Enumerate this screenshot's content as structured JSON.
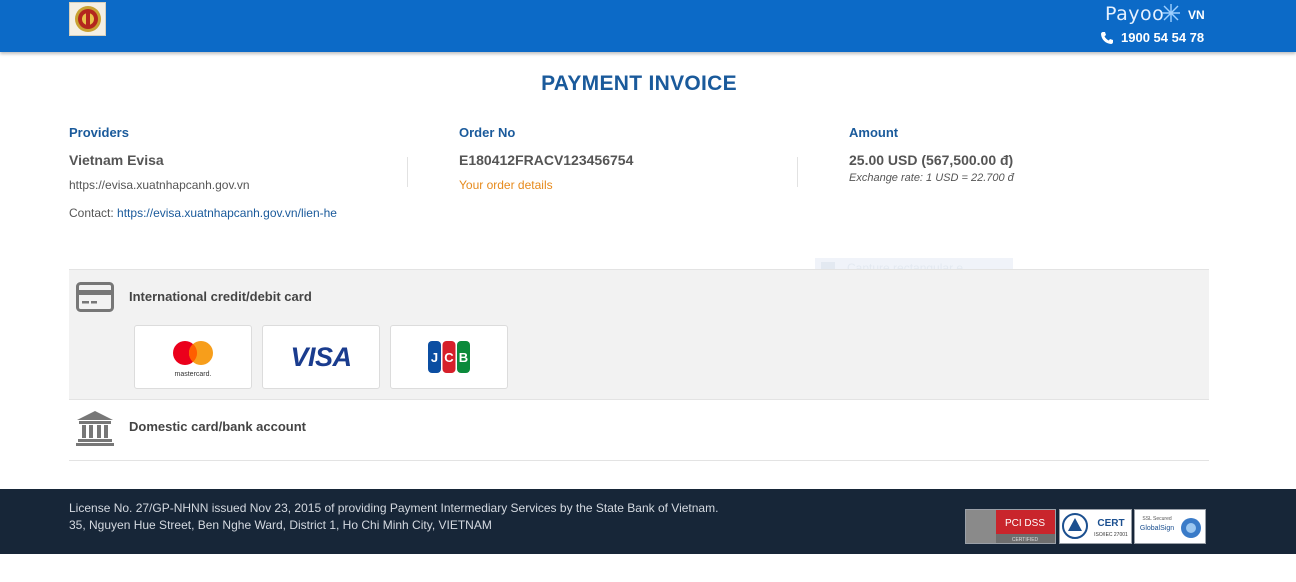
{
  "header": {
    "brand": "Payoo",
    "language": "VN",
    "hotline": "1900 54 54 78",
    "bar_color": "#0c6ac7"
  },
  "page": {
    "title": "PAYMENT INVOICE"
  },
  "invoice": {
    "provider": {
      "label": "Providers",
      "name": "Vietnam Evisa",
      "website": "https://evisa.xuatnhapcanh.gov.vn",
      "contact_label": "Contact:",
      "contact_link": "https://evisa.xuatnhapcanh.gov.vn/lien-he"
    },
    "order": {
      "label": "Order No",
      "number": "E180412FRACV123456754",
      "details_link": "Your order details"
    },
    "amount": {
      "label": "Amount",
      "value": "25.00 USD (567,500.00 đ)",
      "exchange_rate": "Exchange rate: 1 USD = 22.700 đ"
    }
  },
  "overlay": {
    "text": "Capture rectangular e"
  },
  "payment_methods": {
    "international": {
      "label": "International credit/debit card",
      "icon": "credit-card-icon",
      "cards": [
        {
          "name": "mastercard",
          "caption": "mastercard."
        },
        {
          "name": "visa",
          "caption": "VISA"
        },
        {
          "name": "jcb",
          "caption": "JCB"
        }
      ]
    },
    "domestic": {
      "label": "Domestic card/bank account",
      "icon": "bank-icon"
    }
  },
  "footer": {
    "license": "License No. 27/GP-NHNN issued Nov 23, 2015 of providing Payment Intermediary Services by the State Bank of Vietnam.",
    "address": "35, Nguyen Hue Street, Ben Nghe Ward, District 1, Ho Chi Minh City, VIETNAM",
    "badges": [
      {
        "name": "pci-dss",
        "text": "PCI DSS",
        "sub": "CERTIFIED"
      },
      {
        "name": "tuv-cert",
        "text": "CERT",
        "sub": "ISO/IEC 27001"
      },
      {
        "name": "globalsign",
        "text": "GlobalSign",
        "sub": "SSL Secured"
      }
    ]
  }
}
